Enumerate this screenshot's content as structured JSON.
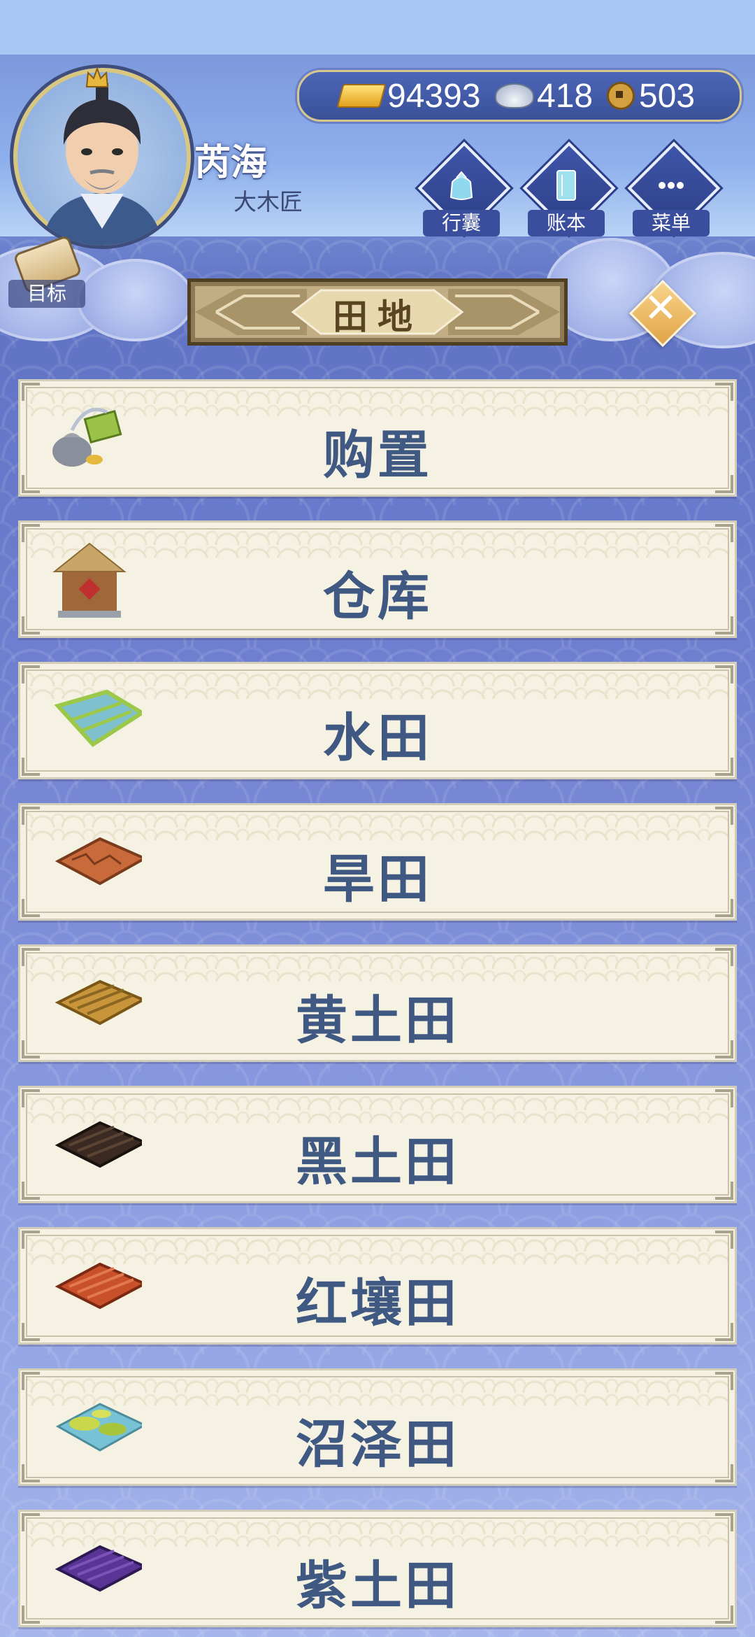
{
  "player": {
    "name": "芮海",
    "title": "大木匠"
  },
  "goal_label": "目标",
  "currency": {
    "gold": "94393",
    "silver": "418",
    "copper": "503"
  },
  "top_buttons": [
    {
      "label": "行囊",
      "icon": "bag-icon"
    },
    {
      "label": "账本",
      "icon": "ledger-icon"
    },
    {
      "label": "菜单",
      "icon": "more-icon"
    }
  ],
  "section_title": "田地",
  "items": [
    {
      "label": "购置",
      "icon": "purchase-icon"
    },
    {
      "label": "仓库",
      "icon": "warehouse-icon"
    },
    {
      "label": "水田",
      "icon": "paddy-field-icon"
    },
    {
      "label": "旱田",
      "icon": "dry-field-icon"
    },
    {
      "label": "黄土田",
      "icon": "yellow-soil-field-icon"
    },
    {
      "label": "黑土田",
      "icon": "black-soil-field-icon"
    },
    {
      "label": "红壤田",
      "icon": "red-soil-field-icon"
    },
    {
      "label": "沼泽田",
      "icon": "swamp-field-icon"
    },
    {
      "label": "紫土田",
      "icon": "purple-soil-field-icon"
    }
  ],
  "colors": {
    "item_text": "#3f5982",
    "yellow_soil": "#c9953a",
    "black_soil": "#3a2a22",
    "red_soil": "#c9512a",
    "purple_soil": "#5b3596",
    "dry_soil": "#c96a3a"
  }
}
